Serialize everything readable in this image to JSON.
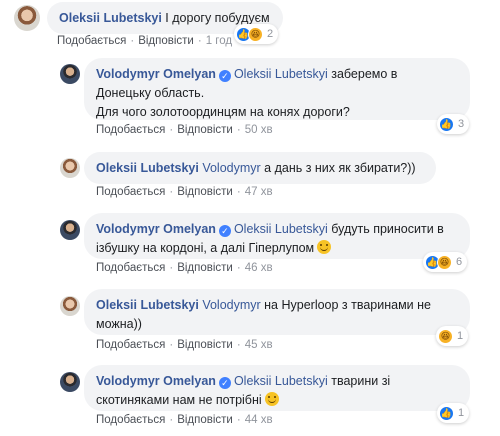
{
  "comments": [
    {
      "author": "Oleksii Lubetskyi",
      "text": " І дорогу побудуєм",
      "like_label": "Подобається",
      "reply_label": "Відповісти",
      "time": "1 год",
      "reaction_count": "2"
    },
    {
      "author": "Volodymyr Omelyan",
      "mention": "Oleksii Lubetskyi",
      "text_line1": " заберемо в",
      "text_line2": "Донецьку область.",
      "text_line3": "Для чого золотоординцям на конях дороги?",
      "like_label": "Подобається",
      "reply_label": "Відповісти",
      "time": "50 хв",
      "reaction_count": "3"
    },
    {
      "author": "Oleksii Lubetskyi",
      "mention": "Volodymyr",
      "text": " а дань з них як збирати?))",
      "like_label": "Подобається",
      "reply_label": "Відповісти",
      "time": "47 хв"
    },
    {
      "author": "Volodymyr Omelyan",
      "mention": "Oleksii Lubetskyi",
      "text_line1": " будуть приносити в",
      "text_line2": "ізбушку на кордоні, а далі Гіперлупом",
      "like_label": "Подобається",
      "reply_label": "Відповісти",
      "time": "46 хв",
      "reaction_count": "6"
    },
    {
      "author": "Oleksii Lubetskyi",
      "mention": "Volodymyr",
      "text_line1": " на Hyperloop з тваринами не",
      "text_line2": "можна))",
      "like_label": "Подобається",
      "reply_label": "Відповісти",
      "time": "45 хв",
      "reaction_count": "1"
    },
    {
      "author": "Volodymyr Omelyan",
      "mention": "Oleksii Lubetskyi",
      "text_line1": " тварини зі",
      "text_line2": "скотиняками нам не потрібні",
      "like_label": "Подобається",
      "reply_label": "Відповісти",
      "time": "44 хв",
      "reaction_count": "1"
    }
  ],
  "icons": {
    "verified": "verified-badge-icon",
    "like": "like-reaction-icon",
    "haha": "haha-reaction-icon",
    "smile": "smile-emoji-icon"
  },
  "colors": {
    "author": "#385898",
    "bubble": "#f2f3f5",
    "like": "#1877f2",
    "verified": "#4080ff",
    "meta": "#90949c"
  }
}
